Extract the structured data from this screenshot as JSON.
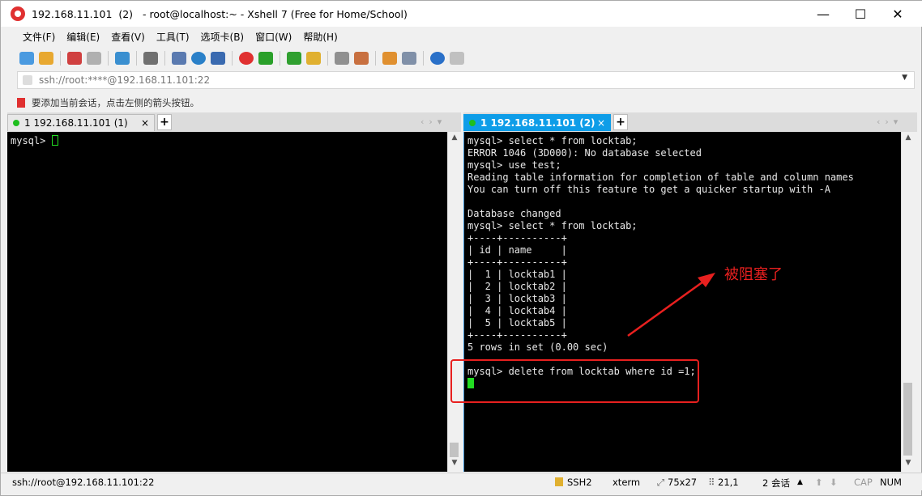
{
  "titlebar": {
    "title": "192.168.11.101  (2)   - root@localhost:~ - Xshell 7 (Free for Home/School)",
    "minimize": "—",
    "maximize": "☐",
    "close": "✕"
  },
  "menu": [
    "文件(F)",
    "编辑(E)",
    "查看(V)",
    "工具(T)",
    "选项卡(B)",
    "窗口(W)",
    "帮助(H)"
  ],
  "address": {
    "value": "ssh://root:****@192.168.11.101:22"
  },
  "hint": {
    "text": "要添加当前会话，点击左侧的箭头按钮。"
  },
  "left_pane": {
    "tab_label": "1 192.168.11.101  (1)",
    "tab_close": "×",
    "terminal_text": "mysql> "
  },
  "right_pane": {
    "tab_label": "1 192.168.11.101  (2)",
    "tab_close": "×",
    "terminal_text": "mysql> select * from locktab;\nERROR 1046 (3D000): No database selected\nmysql> use test;\nReading table information for completion of table and column names\nYou can turn off this feature to get a quicker startup with -A\n\nDatabase changed\nmysql> select * from locktab;\n+----+----------+\n| id | name     |\n+----+----------+\n|  1 | locktab1 |\n|  2 | locktab2 |\n|  3 | locktab3 |\n|  4 | locktab4 |\n|  5 | locktab5 |\n+----+----------+\n5 rows in set (0.00 sec)\n\nmysql> delete from locktab where id =1;\n"
  },
  "annotation": {
    "text": "被阻塞了",
    "color": "#e8201f"
  },
  "statusbar": {
    "connection": "ssh://root@192.168.11.101:22",
    "protocol": "SSH2",
    "term_type": "xterm",
    "size": "75x27",
    "cursor_pos": "21,1",
    "sessions": "2 会话",
    "cap": "CAP",
    "num": "NUM"
  }
}
